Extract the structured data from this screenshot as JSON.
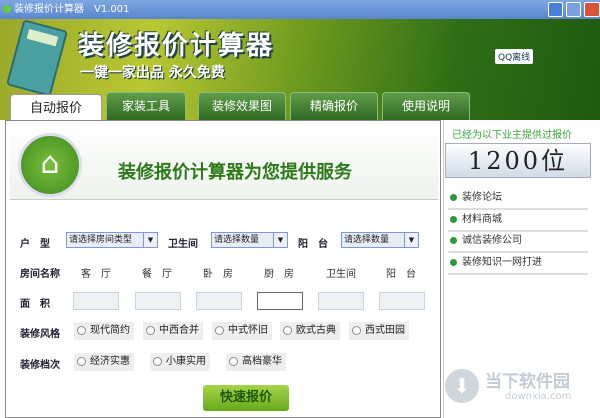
{
  "window": {
    "title": "装修报价计算器　V1.001"
  },
  "banner": {
    "title": "装修报价计算器",
    "subtitle": "一键一家出品 永久免费",
    "qq": "QQ离线"
  },
  "tabs": [
    {
      "label": "自动报价"
    },
    {
      "label": "家装工具"
    },
    {
      "label": "装修效果图"
    },
    {
      "label": "精确报价"
    },
    {
      "label": "使用说明"
    }
  ],
  "header": {
    "title": "装修报价计算器为您提供服务"
  },
  "form": {
    "huxing_label": "户　型",
    "huxing_value": "请选择房间类型",
    "bath_label": "卫生间",
    "bath_value": "请选择数量",
    "balcony_label": "阳　台",
    "balcony_value": "请选择数量",
    "room_label": "房间名称",
    "rooms": [
      "客　厅",
      "餐　厅",
      "卧　房",
      "厨　房",
      "卫生间",
      "阳　台"
    ],
    "area_label": "面　积",
    "style_label": "装修风格",
    "styles": [
      "现代简约",
      "中西合并",
      "中式怀旧",
      "欧式古典",
      "西式田园"
    ],
    "grade_label": "装修档次",
    "grades": [
      "经济实惠",
      "小康实用",
      "高档豪华"
    ],
    "submit": "快速报价"
  },
  "side": {
    "caption": "已经为以下业主提供过报价",
    "count": "1200位",
    "links": [
      "装修论坛",
      "材料商城",
      "诚信装修公司",
      "装修知识一网打进"
    ]
  },
  "watermark": {
    "name": "当下软件园",
    "url": "downxia.com"
  }
}
